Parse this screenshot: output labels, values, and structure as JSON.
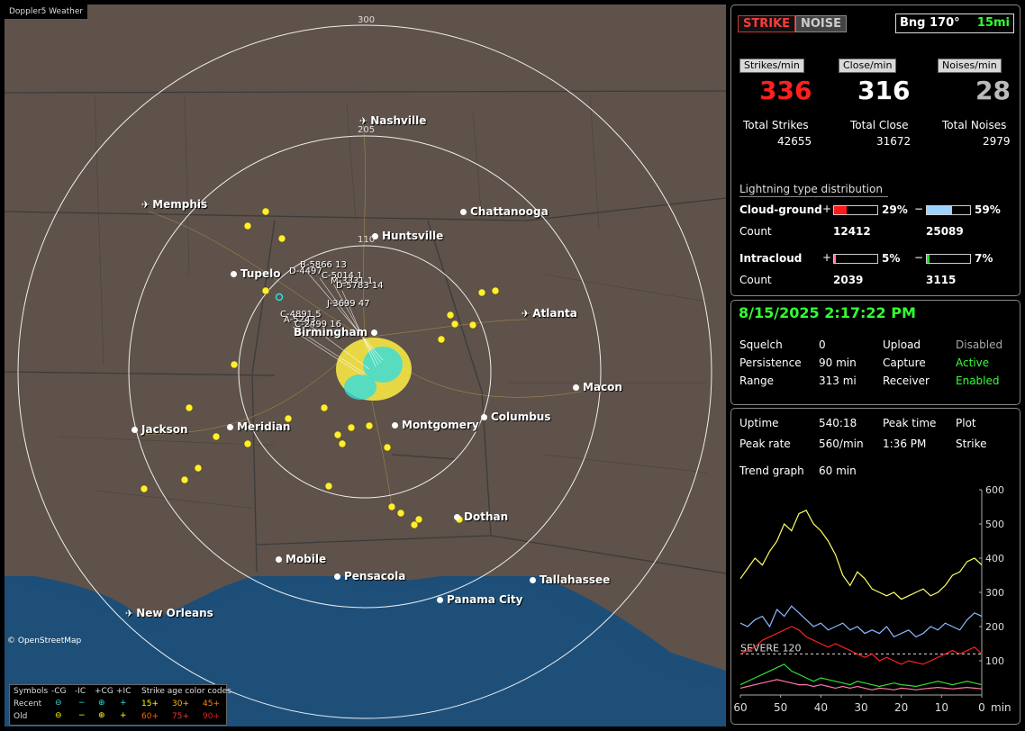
{
  "app": {
    "title": "Doppler5 Weather",
    "credit": "© OpenStreetMap"
  },
  "map": {
    "rings": [
      "300",
      "205",
      "110"
    ],
    "cities": [
      {
        "name": "Nashville",
        "kind": "airport"
      },
      {
        "name": "Memphis",
        "kind": "airport"
      },
      {
        "name": "Chattanooga",
        "kind": "city"
      },
      {
        "name": "Huntsville",
        "kind": "city"
      },
      {
        "name": "Tupelo",
        "kind": "city"
      },
      {
        "name": "Atlanta",
        "kind": "airport"
      },
      {
        "name": "Birmingham",
        "kind": "city"
      },
      {
        "name": "Macon",
        "kind": "city"
      },
      {
        "name": "Jackson",
        "kind": "city"
      },
      {
        "name": "Meridian",
        "kind": "city"
      },
      {
        "name": "Montgomery",
        "kind": "city"
      },
      {
        "name": "Columbus",
        "kind": "city"
      },
      {
        "name": "Dothan",
        "kind": "city"
      },
      {
        "name": "Mobile",
        "kind": "city"
      },
      {
        "name": "Pensacola",
        "kind": "city"
      },
      {
        "name": "Tallahassee",
        "kind": "city"
      },
      {
        "name": "Panama City",
        "kind": "city"
      },
      {
        "name": "New Orleans",
        "kind": "airport"
      }
    ],
    "strike_labels": [
      "B-5866 13",
      "D-4497",
      "C-5014 1",
      "M-3331 1",
      "D-5783 14",
      "J-3699 47",
      "C-4891 5",
      "A-5243",
      "C-2499 16"
    ],
    "legend": {
      "symbols_label": "Symbols",
      "cols": [
        "-CG",
        "-IC",
        "+CG",
        "+IC"
      ],
      "age_label": "Strike age color codes",
      "recent_label": "Recent",
      "old_label": "Old",
      "recent_ages": [
        "15+",
        "30+",
        "45+"
      ],
      "old_ages": [
        "60+",
        "75+",
        "90+"
      ]
    }
  },
  "panel": {
    "mode_strike": "STRIKE",
    "mode_noise": "NOISE",
    "bearing": "Bng 170°",
    "range_badge": "15mi",
    "rates": [
      {
        "label": "Strikes/min",
        "value": "336",
        "total_label": "Total Strikes",
        "total": "42655",
        "color": "#ff2020"
      },
      {
        "label": "Close/min",
        "value": "316",
        "total_label": "Total Close",
        "total": "31672",
        "color": "#ffffff"
      },
      {
        "label": "Noises/min",
        "value": "28",
        "total_label": "Total Noises",
        "total": "2979",
        "color": "#bbbbbb"
      }
    ],
    "dist_title": "Lightning type distribution",
    "cloud_ground": {
      "label": "Cloud-ground",
      "pos_sign": "+",
      "pos_pct": "29%",
      "pos_frac": 0.29,
      "neg_sign": "−",
      "neg_pct": "59%",
      "neg_frac": 0.59,
      "count_label": "Count",
      "pos_count": "12412",
      "neg_count": "25089"
    },
    "intracloud": {
      "label": "Intracloud",
      "pos_sign": "+",
      "pos_pct": "5%",
      "pos_frac": 0.05,
      "neg_sign": "−",
      "neg_pct": "7%",
      "neg_frac": 0.07,
      "count_label": "Count",
      "pos_count": "2039",
      "neg_count": "3115"
    },
    "colors": {
      "cg_pos": "#ff1a1a",
      "cg_neg": "#9cd2ff",
      "ic_pos": "#ff7ab0",
      "ic_neg": "#22dd22"
    }
  },
  "status": {
    "datetime": "8/15/2025 2:17:22 PM",
    "rows": [
      [
        "Squelch",
        "0",
        "Upload",
        "Disabled"
      ],
      [
        "Persistence",
        "90 min",
        "Capture",
        "Active"
      ],
      [
        "Range",
        "313 mi",
        "Receiver",
        "Enabled"
      ]
    ]
  },
  "stats": {
    "uptime_label": "Uptime",
    "uptime": "540:18",
    "peak_time_label": "Peak time",
    "peak_time": "1:36 PM",
    "plot_label": "Plot",
    "plot_value": "Strike",
    "peak_rate_label": "Peak rate",
    "peak_rate": "560/min",
    "trend_label": "Trend graph",
    "trend_value": "60 min",
    "severe_label": "SEVERE 120"
  },
  "chart_data": {
    "type": "line",
    "xlabel": "min",
    "x_ticks": [
      "60",
      "50",
      "40",
      "30",
      "20",
      "10",
      "0"
    ],
    "y_ticks": [
      "600",
      "500",
      "400",
      "300",
      "200",
      "100"
    ],
    "xlim": [
      60,
      0
    ],
    "ylim": [
      0,
      600
    ],
    "series": [
      {
        "color": "#ffff66",
        "values": [
          340,
          370,
          400,
          380,
          420,
          450,
          500,
          480,
          530,
          540,
          500,
          480,
          450,
          410,
          350,
          320,
          360,
          340,
          310,
          300,
          290,
          300,
          280,
          290,
          300,
          310,
          290,
          300,
          320,
          350,
          360,
          390,
          400,
          380
        ]
      },
      {
        "color": "#8fb8ff",
        "values": [
          210,
          200,
          220,
          230,
          200,
          250,
          230,
          260,
          240,
          220,
          200,
          210,
          190,
          200,
          210,
          190,
          200,
          180,
          190,
          180,
          200,
          170,
          180,
          190,
          170,
          180,
          200,
          190,
          210,
          200,
          190,
          220,
          240,
          230
        ]
      },
      {
        "color": "#ff2020",
        "values": [
          120,
          130,
          140,
          160,
          170,
          180,
          190,
          200,
          190,
          170,
          160,
          150,
          140,
          150,
          140,
          130,
          120,
          110,
          120,
          100,
          110,
          100,
          90,
          100,
          95,
          90,
          100,
          110,
          120,
          130,
          120,
          130,
          140,
          120
        ]
      },
      {
        "color": "#33dd33",
        "values": [
          30,
          40,
          50,
          60,
          70,
          80,
          90,
          70,
          60,
          50,
          40,
          50,
          45,
          40,
          35,
          30,
          40,
          35,
          30,
          25,
          30,
          35,
          30,
          28,
          25,
          30,
          35,
          40,
          35,
          30,
          35,
          40,
          35,
          30
        ]
      },
      {
        "color": "#ff77aa",
        "values": [
          20,
          25,
          30,
          35,
          40,
          45,
          40,
          35,
          30,
          30,
          25,
          30,
          25,
          20,
          25,
          20,
          25,
          20,
          15,
          20,
          18,
          15,
          20,
          18,
          15,
          18,
          20,
          22,
          20,
          18,
          20,
          22,
          20,
          18
        ]
      }
    ],
    "severe_threshold": 120
  }
}
